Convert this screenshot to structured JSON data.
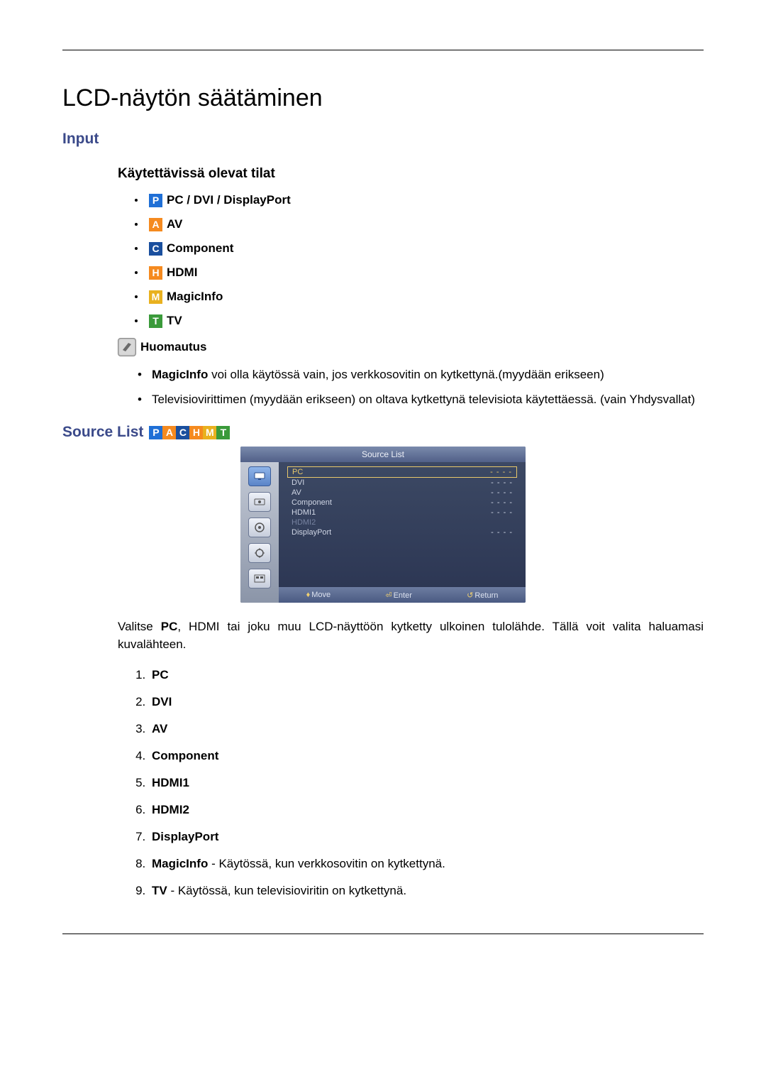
{
  "title": "LCD-näytön säätäminen",
  "section_input": "Input",
  "available_modes_heading": "Käytettävissä olevat tilat",
  "modes": [
    {
      "letter": "P",
      "cls": "badge-P",
      "label": "PC / DVI / DisplayPort"
    },
    {
      "letter": "A",
      "cls": "badge-A",
      "label": "AV"
    },
    {
      "letter": "C",
      "cls": "badge-C",
      "label": "Component"
    },
    {
      "letter": "H",
      "cls": "badge-H",
      "label": "HDMI"
    },
    {
      "letter": "M",
      "cls": "badge-M",
      "label": "MagicInfo"
    },
    {
      "letter": "T",
      "cls": "badge-T",
      "label": "TV"
    }
  ],
  "note_label": "Huomautus",
  "notes": {
    "n1_b": "MagicInfo",
    "n1_rest": " voi olla käytössä vain, jos verkkosovitin on kytkettynä.(myydään erikseen)",
    "n2": "Televisiovirittimen (myydään erikseen) on oltava kytkettynä televisiota käytettäessä. (vain Yhdysvallat)"
  },
  "source_list_heading": "Source List",
  "strip": [
    "P",
    "A",
    "C",
    "H",
    "M",
    "T"
  ],
  "strip_cls": [
    "badge-P",
    "badge-A",
    "badge-C",
    "badge-H",
    "badge-M",
    "badge-T"
  ],
  "osd": {
    "title": "Source List",
    "rows": [
      {
        "label": "PC",
        "val": "- - - -",
        "state": "current"
      },
      {
        "label": "DVI",
        "val": "- - - -",
        "state": ""
      },
      {
        "label": "AV",
        "val": "- - - -",
        "state": ""
      },
      {
        "label": "Component",
        "val": "- - - -",
        "state": ""
      },
      {
        "label": "HDMI1",
        "val": "- - - -",
        "state": ""
      },
      {
        "label": "HDMI2",
        "val": "",
        "state": "dim"
      },
      {
        "label": "DisplayPort",
        "val": "- - - -",
        "state": ""
      }
    ],
    "foot_move": "Move",
    "foot_enter": "Enter",
    "foot_return": "Return"
  },
  "para_pre": "Valitse ",
  "para_bold": "PC",
  "para_post": ", HDMI tai joku muu LCD-näyttöön kytketty ulkoinen tulolähde. Tällä voit valita haluamasi kuvalähteen.",
  "num_list": {
    "i1": "PC",
    "i2": "DVI",
    "i3": "AV",
    "i4": "Component",
    "i5": "HDMI1",
    "i6": "HDMI2",
    "i7": "DisplayPort",
    "i8_b": "MagicInfo",
    "i8_rest": " - Käytössä, kun verkkosovitin on kytkettynä.",
    "i9_b": "TV",
    "i9_rest": " - Käytössä, kun televisioviritin on kytkettynä."
  }
}
